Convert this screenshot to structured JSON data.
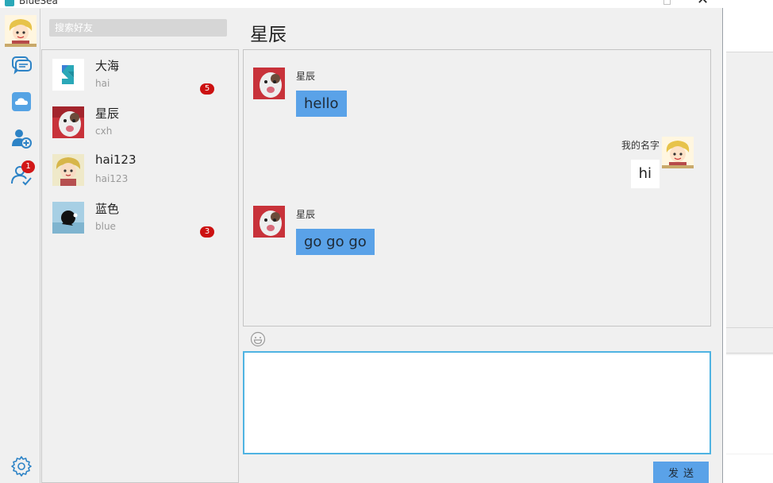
{
  "window": {
    "title": "BlueSea"
  },
  "rail": {
    "notification_count": "1",
    "icons": [
      "chat-icon",
      "cloud-icon",
      "add-user-icon",
      "friend-request-icon",
      "settings-icon"
    ]
  },
  "search": {
    "placeholder": "搜索好友",
    "value": ""
  },
  "contacts": [
    {
      "name": "大海",
      "sub": "hai",
      "badge": "5"
    },
    {
      "name": "星辰",
      "sub": "cxh",
      "badge": ""
    },
    {
      "name": "hai123",
      "sub": "hai123",
      "badge": ""
    },
    {
      "name": "蓝色",
      "sub": "blue",
      "badge": "3"
    }
  ],
  "chat": {
    "title": "星辰",
    "messages": [
      {
        "direction": "in",
        "sender": "星辰",
        "text": "hello"
      },
      {
        "direction": "out",
        "sender": "我的名字",
        "text": "hi"
      },
      {
        "direction": "in",
        "sender": "星辰",
        "text": "go go go"
      }
    ]
  },
  "composer": {
    "value": "",
    "send_label": "发送"
  },
  "colors": {
    "accent": "#5aa2e8",
    "input_border": "#4fb3e2",
    "badge": "#cc1111"
  }
}
